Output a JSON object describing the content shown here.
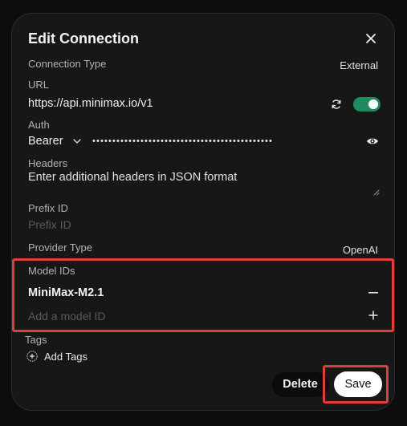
{
  "dialog": {
    "title": "Edit Connection"
  },
  "connection_type": {
    "label": "Connection Type",
    "value": "External"
  },
  "url": {
    "label": "URL",
    "value": "https://api.minimax.io/v1",
    "enabled": true
  },
  "auth": {
    "label": "Auth",
    "type": "Bearer",
    "masked_key": "•••••••••••••••••••••••••••••••••••••••••••••"
  },
  "headers": {
    "label": "Headers",
    "placeholder": "Enter additional headers in JSON format"
  },
  "prefix_id": {
    "label": "Prefix ID",
    "placeholder": "Prefix ID"
  },
  "provider_type": {
    "label": "Provider Type",
    "value": "OpenAI"
  },
  "model_ids": {
    "label": "Model IDs",
    "items": [
      "MiniMax-M2.1"
    ],
    "add_placeholder": "Add a model ID"
  },
  "tags": {
    "label": "Tags",
    "add_label": "Add Tags"
  },
  "actions": {
    "delete_label": "Delete",
    "save_label": "Save"
  },
  "colors": {
    "toggle_on": "#1f8a5c",
    "highlight": "#e03c3c",
    "background": "#171717"
  },
  "icons": [
    "close-icon",
    "refresh-icon",
    "eye-icon",
    "chevron-down-icon",
    "minus-icon",
    "plus-icon",
    "add-circle-icon"
  ]
}
